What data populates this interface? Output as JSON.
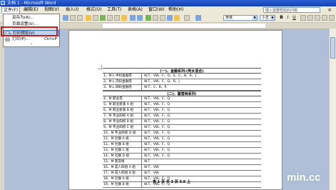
{
  "window": {
    "title": "文档 1 - Microsoft Word"
  },
  "menubar": {
    "items": [
      "文件(F)",
      "编辑(E)",
      "视图(V)",
      "插入(I)",
      "格式(O)",
      "工具(T)",
      "表格(A)",
      "窗口(W)",
      "帮助(H)"
    ],
    "help_placeholder": "键入需要帮助的问题",
    "close_glyph": "×"
  },
  "toolbar": {
    "font_name": "宋体",
    "font_size": "小五",
    "bold": "B",
    "italic": "I",
    "underline": "U"
  },
  "file_menu": {
    "items": [
      {
        "label": "另存为(A)...",
        "shortcut": ""
      },
      {
        "label": "页面设置(U)...",
        "shortcut": ""
      },
      {
        "label": "打印预览(V)",
        "shortcut": ""
      },
      {
        "label": "打印(P)...",
        "shortcut": "Ctrl+P"
      }
    ],
    "more_glyph": "⌄"
  },
  "document": {
    "heading1": "(一)、金融系列:(男女混合)",
    "heading2": "(二)、徽营商系列:",
    "rows": [
      {
        "c1": "1、M.L 中码金融卷",
        "c2": "W.T、VW、F、Q、S、C、B、R、J"
      },
      {
        "c1": "2、M.L 内码金融卷",
        "c2": "W.T、VW、F、Q、R、J"
      },
      {
        "c1": "3、M.L 四码金融卷",
        "c2": "W.T、C、B、R"
      },
      {
        "c1": "4、M 职业卷",
        "c2": "W.T、VW、F、Q"
      },
      {
        "c1": "5、M 职业新基 A 组",
        "c2": "W.T、VW、F、Q"
      },
      {
        "c1": "6、M 职业新基 B 组",
        "c2": "W.T、VW、F、Q"
      },
      {
        "c1": "7、M 专业四校 A 组",
        "c2": "W.T、VW、F、Q"
      },
      {
        "c1": "8、M 专业四校 B 组",
        "c2": "W.T、VW、F、Q"
      },
      {
        "c1": "9、M 专业四校 C 组",
        "c2": "W.T、VW、F、Q"
      },
      {
        "c1": "10、M 专业四校 D 组",
        "c2": "W.T、VW、F、Q"
      },
      {
        "c1": "11、M 社群 A 组",
        "c2": "W.T、VW、F、Q"
      },
      {
        "c1": "12、M 社群 B 组",
        "c2": "W.T、VW、F、Q"
      },
      {
        "c1": "13、M 社群 C 组",
        "c2": "W.T、VW、F、Q"
      },
      {
        "c1": "14、M 社群 D 组",
        "c2": "W.T、VW、F、Q"
      },
      {
        "c1": "15、M 家常组",
        "c2": "W.T"
      },
      {
        "c1": "16、M 成人四组 A 组",
        "c2": "W.T、VW"
      },
      {
        "c1": "17、M 成人四组 B 组",
        "c2": "W.T、VW"
      },
      {
        "c1": "18、M 社群 A 组",
        "c2": "W.T、VW、F、Q"
      },
      {
        "c1": "19、M 社群 B 组",
        "c2": "W.T、VW、F、Q"
      }
    ],
    "footer_note": "第 1 页 共 3 页 3.5 上"
  },
  "watermark": "min.cc",
  "colors": {
    "highlight": "#c1d2ee",
    "annotation_red": "#d01818",
    "titlebar": "#1742b0"
  }
}
